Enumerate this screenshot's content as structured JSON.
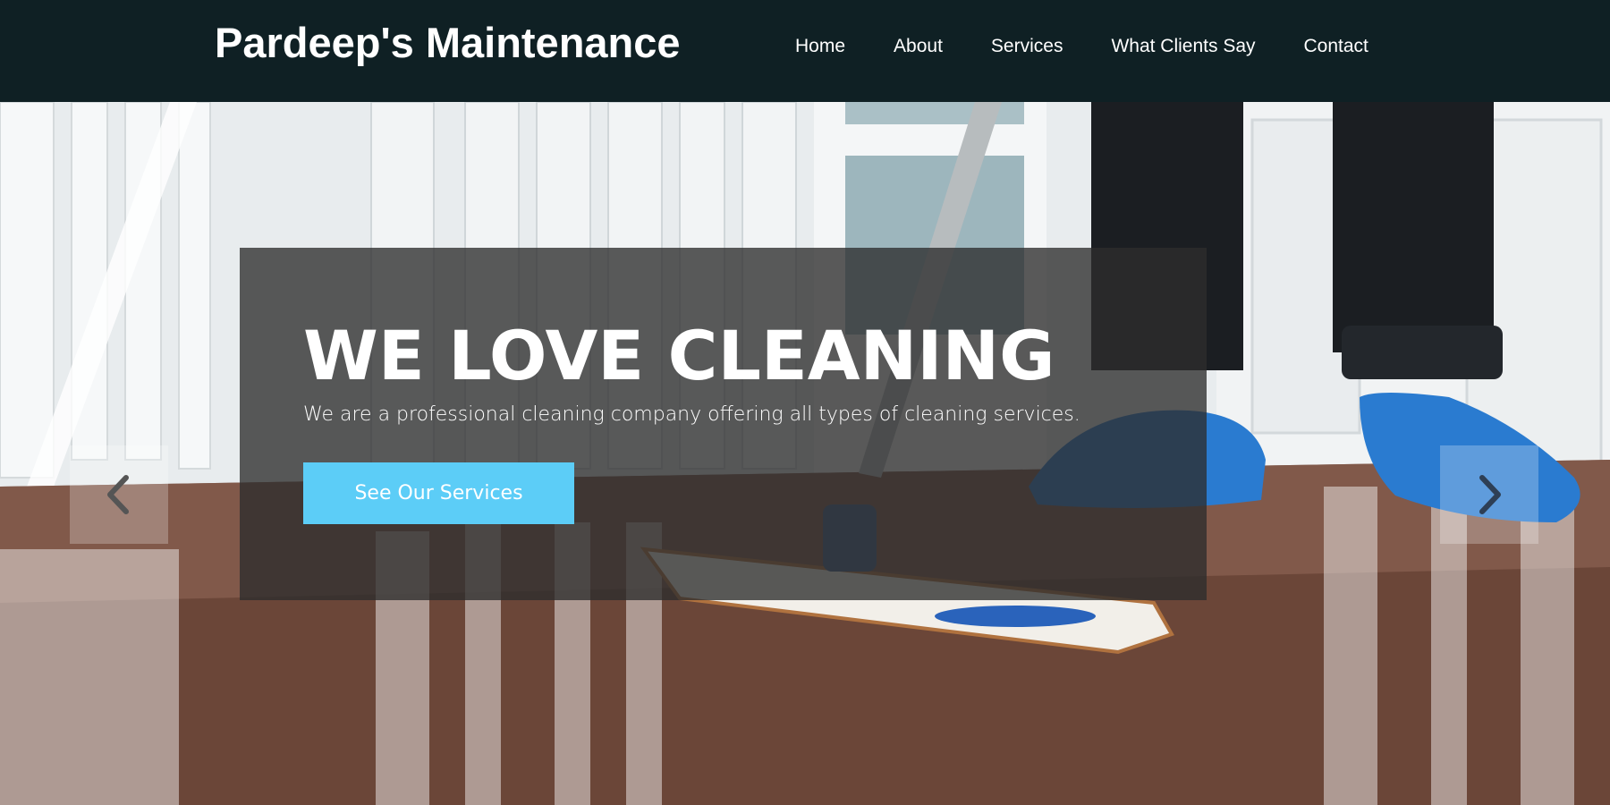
{
  "header": {
    "brand": "Pardeep's Maintenance",
    "nav": [
      {
        "label": "Home"
      },
      {
        "label": "About"
      },
      {
        "label": "Services"
      },
      {
        "label": "What Clients Say"
      },
      {
        "label": "Contact"
      }
    ]
  },
  "hero": {
    "title": "WE LOVE CLEANING",
    "subtitle": "We are a professional cleaning company offering all types of cleaning services.",
    "cta_label": "See Our Services",
    "prev_icon": "chevron-left-icon",
    "next_icon": "chevron-right-icon"
  },
  "colors": {
    "header_bg": "#0f2024",
    "overlay_bg": "#2d2d2d",
    "cta_bg": "#5ccdf7",
    "text": "#ffffff"
  }
}
